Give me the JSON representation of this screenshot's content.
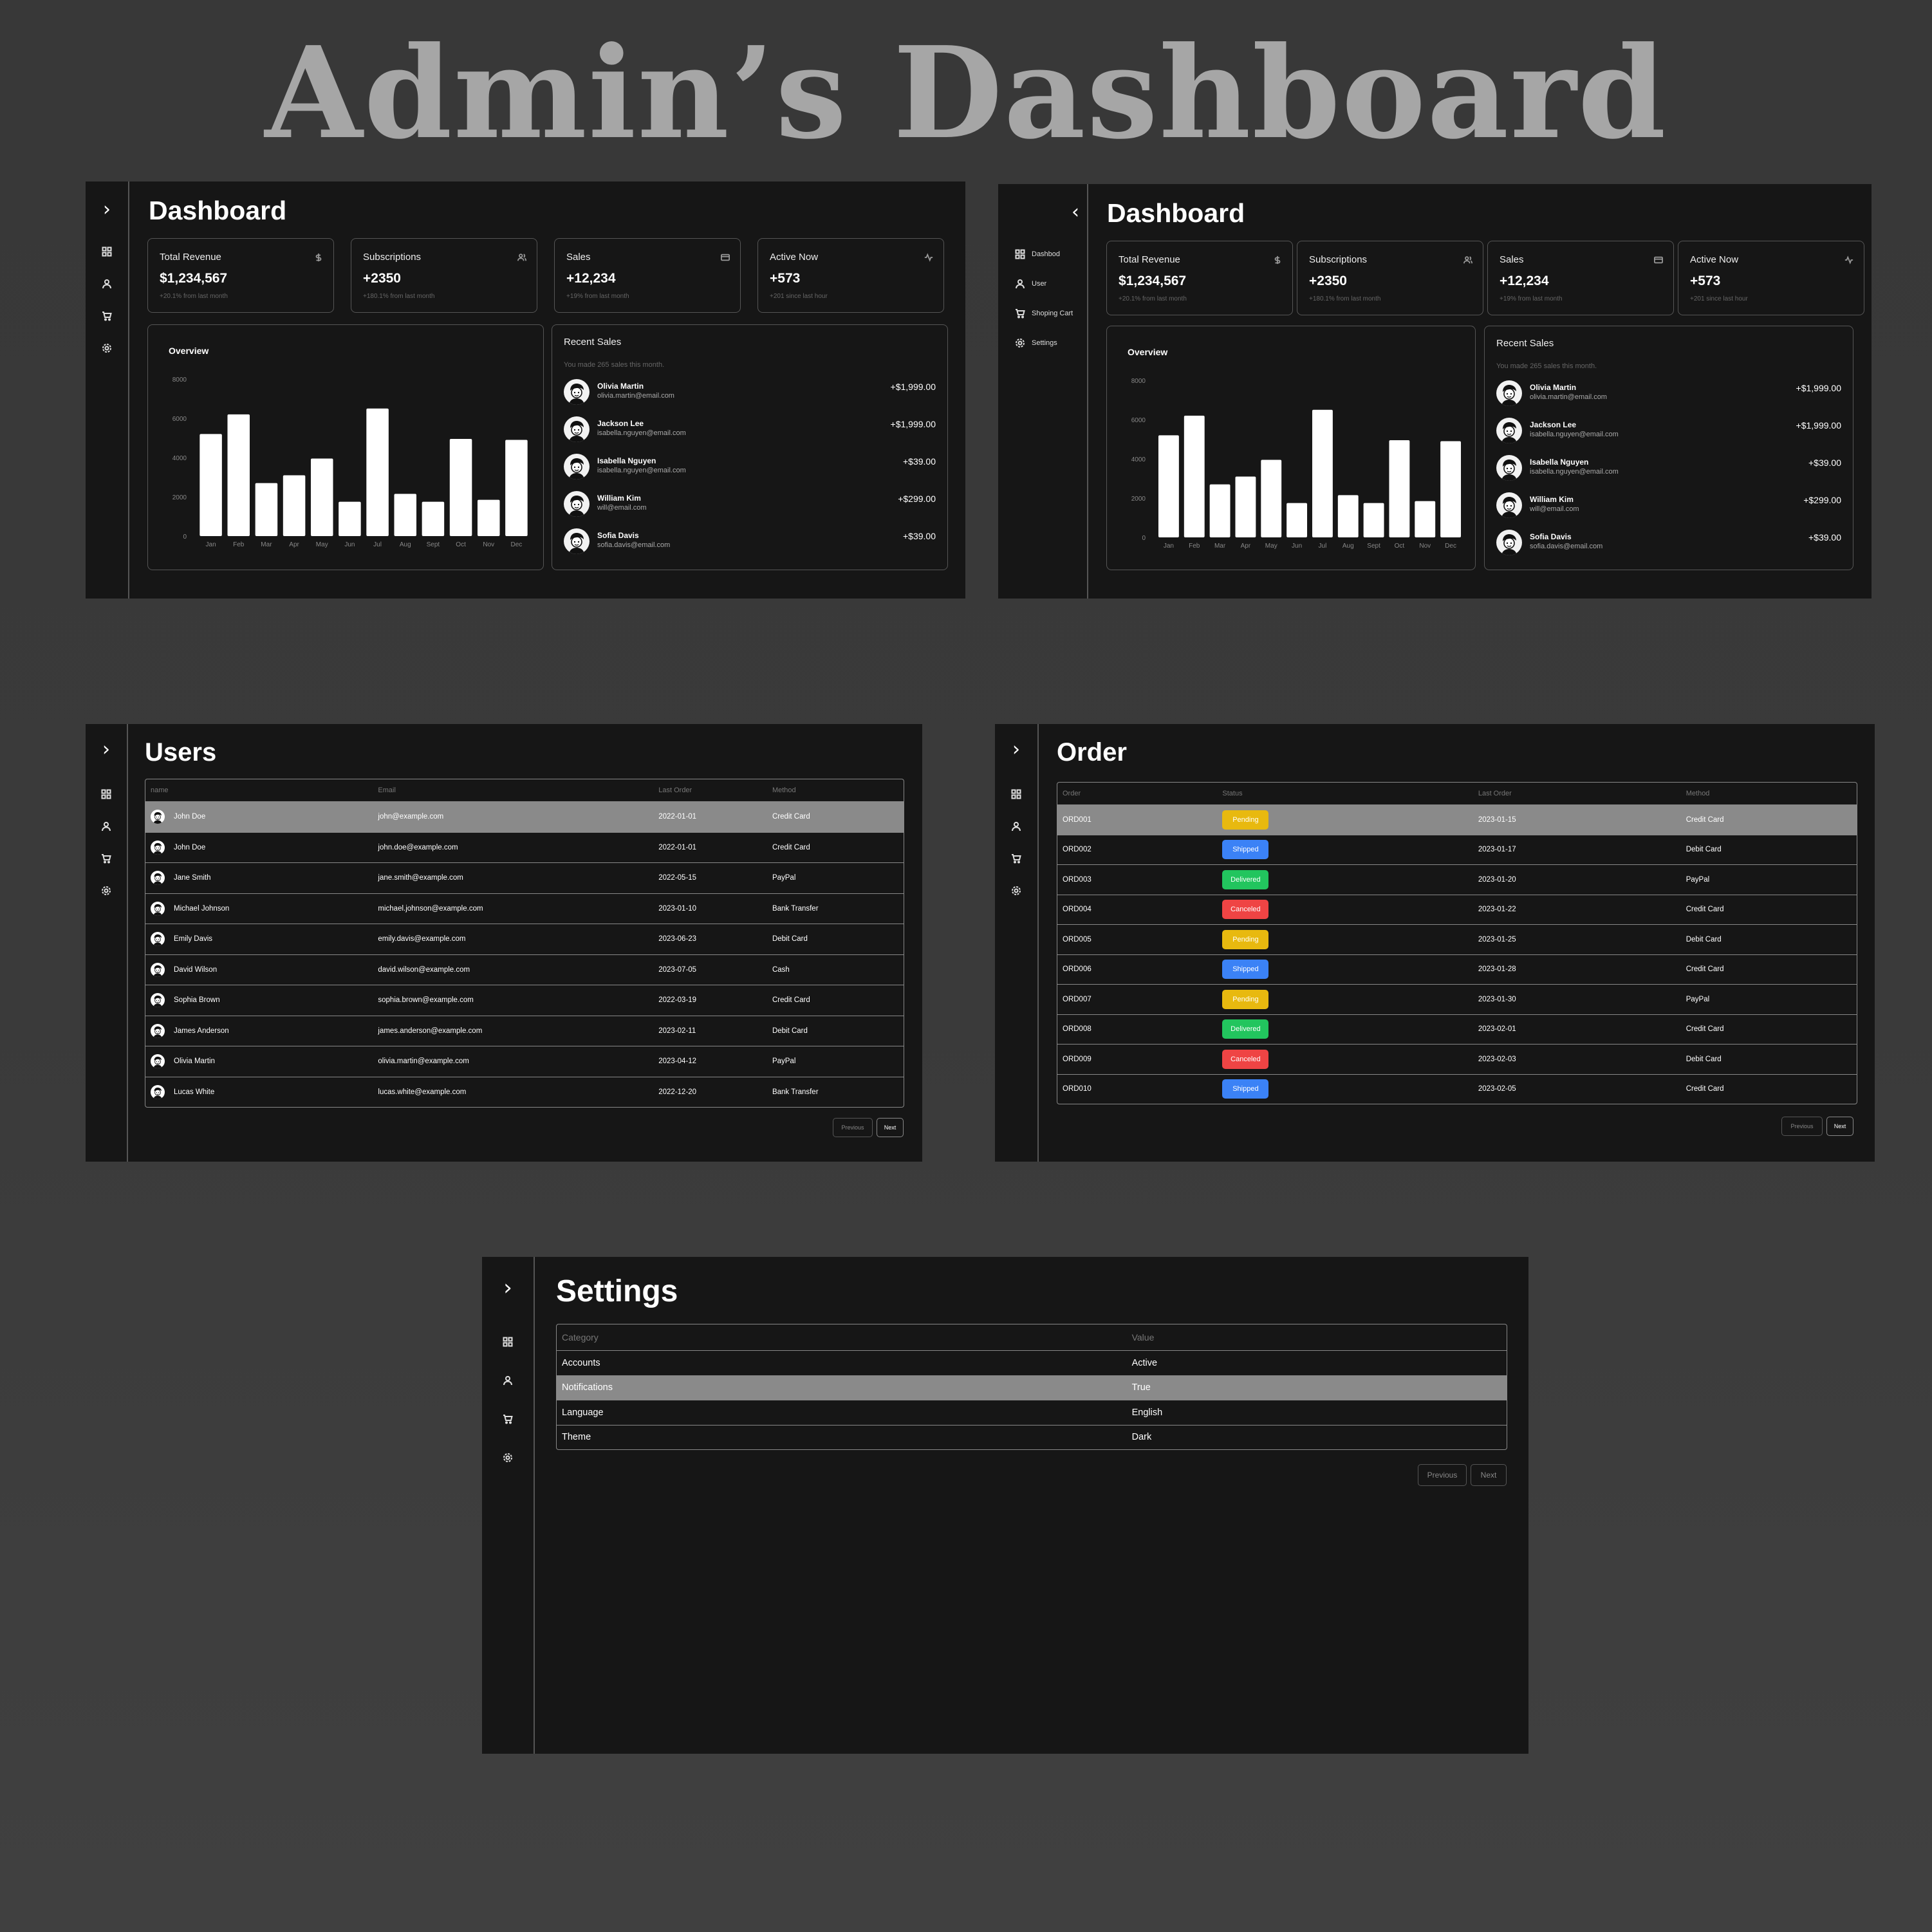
{
  "main_title": "Admin’s Dashboard",
  "nav": {
    "toggle_collapsed": "›",
    "toggle_expanded": "‹",
    "items": [
      "Dashbod",
      "User",
      "Shoping Cart",
      "Settings"
    ]
  },
  "dashboard": {
    "title": "Dashboard",
    "cards": [
      {
        "title": "Total Revenue",
        "icon": "dollar-icon",
        "value": "$1,234,567",
        "sub": "+20.1% from last month"
      },
      {
        "title": "Subscriptions",
        "icon": "users-icon",
        "value": "+2350",
        "sub": "+180.1% from last month"
      },
      {
        "title": "Sales",
        "icon": "credit-card-icon",
        "value": "+12,234",
        "sub": "+19% from last month"
      },
      {
        "title": "Active Now",
        "icon": "activity-icon",
        "value": "+573",
        "sub": "+201 since last hour"
      }
    ],
    "overview_title": "Overview",
    "recent_sales": {
      "title": "Recent Sales",
      "description": "You made 265 sales this month.",
      "items": [
        {
          "name": "Olivia Martin",
          "email": "olivia.martin@email.com",
          "amount": "+$1,999.00"
        },
        {
          "name": "Jackson Lee",
          "email": "isabella.nguyen@email.com",
          "amount": "+$1,999.00"
        },
        {
          "name": "Isabella Nguyen",
          "email": "isabella.nguyen@email.com",
          "amount": "+$39.00"
        },
        {
          "name": "William Kim",
          "email": "will@email.com",
          "amount": "+$299.00"
        },
        {
          "name": "Sofia Davis",
          "email": "sofia.davis@email.com",
          "amount": "+$39.00"
        }
      ]
    }
  },
  "chart_data": {
    "type": "bar",
    "title": "Overview",
    "categories": [
      "Jan",
      "Feb",
      "Mar",
      "Apr",
      "May",
      "Jun",
      "Jul",
      "Aug",
      "Sept",
      "Oct",
      "Nov",
      "Dec"
    ],
    "values": [
      5200,
      6200,
      2700,
      3100,
      3950,
      1750,
      6500,
      2150,
      1750,
      4950,
      1850,
      4900
    ],
    "yticks": [
      "0",
      "2000",
      "4000",
      "6000",
      "8000"
    ],
    "ylim": [
      0,
      8000
    ],
    "bar_color": "#ffffff",
    "grid": false
  },
  "users": {
    "title": "Users",
    "columns": [
      "name",
      "Email",
      "Last Order",
      "Method"
    ],
    "rows": [
      [
        "John Doe",
        "john@example.com",
        "2022-01-01",
        "Credit Card"
      ],
      [
        "John Doe",
        "john.doe@example.com",
        "2022-01-01",
        "Credit Card"
      ],
      [
        "Jane Smith",
        "jane.smith@example.com",
        "2022-05-15",
        "PayPal"
      ],
      [
        "Michael Johnson",
        "michael.johnson@example.com",
        "2023-01-10",
        "Bank Transfer"
      ],
      [
        "Emily Davis",
        "emily.davis@example.com",
        "2023-06-23",
        "Debit Card"
      ],
      [
        "David Wilson",
        "david.wilson@example.com",
        "2023-07-05",
        "Cash"
      ],
      [
        "Sophia Brown",
        "sophia.brown@example.com",
        "2022-03-19",
        "Credit Card"
      ],
      [
        "James Anderson",
        "james.anderson@example.com",
        "2023-02-11",
        "Debit Card"
      ],
      [
        "Olivia Martin",
        "olivia.martin@example.com",
        "2023-04-12",
        "PayPal"
      ],
      [
        "Lucas White",
        "lucas.white@example.com",
        "2022-12-20",
        "Bank Transfer"
      ]
    ],
    "prev_label": "Previous",
    "next_label": "Next"
  },
  "orders": {
    "title": "Order",
    "columns": [
      "Order",
      "Status",
      "Last Order",
      "Method"
    ],
    "rows": [
      [
        "ORD001",
        "Pending",
        "2023-01-15",
        "Credit Card"
      ],
      [
        "ORD002",
        "Shipped",
        "2023-01-17",
        "Debit Card"
      ],
      [
        "ORD003",
        "Delivered",
        "2023-01-20",
        "PayPal"
      ],
      [
        "ORD004",
        "Canceled",
        "2023-01-22",
        "Credit Card"
      ],
      [
        "ORD005",
        "Pending",
        "2023-01-25",
        "Debit Card"
      ],
      [
        "ORD006",
        "Shipped",
        "2023-01-28",
        "Credit Card"
      ],
      [
        "ORD007",
        "Pending",
        "2023-01-30",
        "PayPal"
      ],
      [
        "ORD008",
        "Delivered",
        "2023-02-01",
        "Credit Card"
      ],
      [
        "ORD009",
        "Canceled",
        "2023-02-03",
        "Debit Card"
      ],
      [
        "ORD010",
        "Shipped",
        "2023-02-05",
        "Credit Card"
      ]
    ],
    "status_colors": {
      "Pending": "#e8b90f",
      "Shipped": "#3b82f6",
      "Delivered": "#22c55e",
      "Canceled": "#ef4444"
    },
    "prev_label": "Previous",
    "next_label": "Next"
  },
  "settings": {
    "title": "Settings",
    "columns": [
      "Category",
      "Value"
    ],
    "rows": [
      [
        "Accounts",
        "Active"
      ],
      [
        "Notifications",
        "True"
      ],
      [
        "Language",
        "English"
      ],
      [
        "Theme",
        "Dark"
      ]
    ],
    "prev_label": "Previous",
    "next_label": "Next"
  }
}
